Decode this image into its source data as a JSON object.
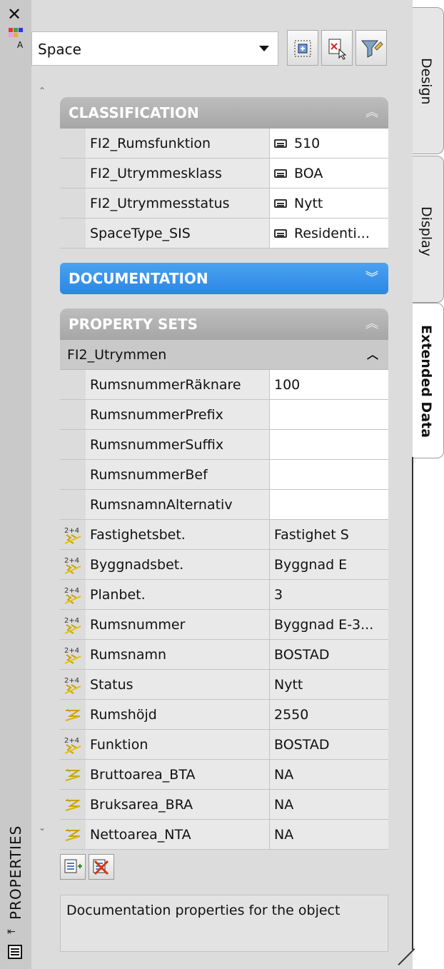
{
  "palette": {
    "title": "PROPERTIES",
    "object_type": "Space",
    "tabs": [
      {
        "label": "Design",
        "active": false
      },
      {
        "label": "Display",
        "active": false
      },
      {
        "label": "Extended Data",
        "active": true
      }
    ]
  },
  "toolbar": {
    "select_objects": "select-objects-icon",
    "quick_select": "quick-select-icon",
    "toggle_pickadd": "filter-icon"
  },
  "classification": {
    "title": "CLASSIFICATION",
    "rows": [
      {
        "name": "FI2_Rumsfunktion",
        "value": "510"
      },
      {
        "name": "FI2_Utrymmesklass",
        "value": "BOA"
      },
      {
        "name": "FI2_Utrymmesstatus",
        "value": "Nytt"
      },
      {
        "name": "SpaceType_SIS",
        "value": "Residenti..."
      }
    ]
  },
  "documentation": {
    "title": "DOCUMENTATION"
  },
  "property_sets": {
    "title": "PROPERTY SETS",
    "set_name": "FI2_Utrymmen",
    "rows": [
      {
        "name": "RumsnummerRäknare",
        "value": "100",
        "icon": "",
        "readonly": false
      },
      {
        "name": "RumsnummerPrefix",
        "value": "",
        "icon": "",
        "readonly": false
      },
      {
        "name": "RumsnummerSuffix",
        "value": "",
        "icon": "",
        "readonly": false
      },
      {
        "name": "RumsnummerBef",
        "value": "",
        "icon": "",
        "readonly": false
      },
      {
        "name": "RumsnamnAlternativ",
        "value": "",
        "icon": "",
        "readonly": false
      },
      {
        "name": "Fastighetsbet.",
        "value": "Fastighet S",
        "icon": "formula-icon",
        "readonly": true
      },
      {
        "name": "Byggnadsbet.",
        "value": "Byggnad E",
        "icon": "formula-icon",
        "readonly": true
      },
      {
        "name": "Planbet.",
        "value": "3",
        "icon": "formula-icon",
        "readonly": true
      },
      {
        "name": "Rumsnummer",
        "value": "Byggnad E-3...",
        "icon": "formula-icon",
        "readonly": true
      },
      {
        "name": "Rumsnamn",
        "value": "BOSTAD",
        "icon": "formula-icon",
        "readonly": true
      },
      {
        "name": "Status",
        "value": "Nytt",
        "icon": "formula-icon",
        "readonly": true
      },
      {
        "name": "Rumshöjd",
        "value": "2550",
        "icon": "automatic-icon",
        "readonly": true
      },
      {
        "name": "Funktion",
        "value": "BOSTAD",
        "icon": "formula-icon",
        "readonly": true
      },
      {
        "name": "Bruttoarea_BTA",
        "value": "NA",
        "icon": "automatic-icon",
        "readonly": true
      },
      {
        "name": "Bruksarea_BRA",
        "value": "NA",
        "icon": "automatic-icon",
        "readonly": true
      },
      {
        "name": "Nettoarea_NTA",
        "value": "NA",
        "icon": "automatic-icon",
        "readonly": true
      }
    ]
  },
  "description": "Documentation properties for the object",
  "colors": {
    "category_gray": "#a6a6a6",
    "category_blue": "#2c86e3"
  }
}
